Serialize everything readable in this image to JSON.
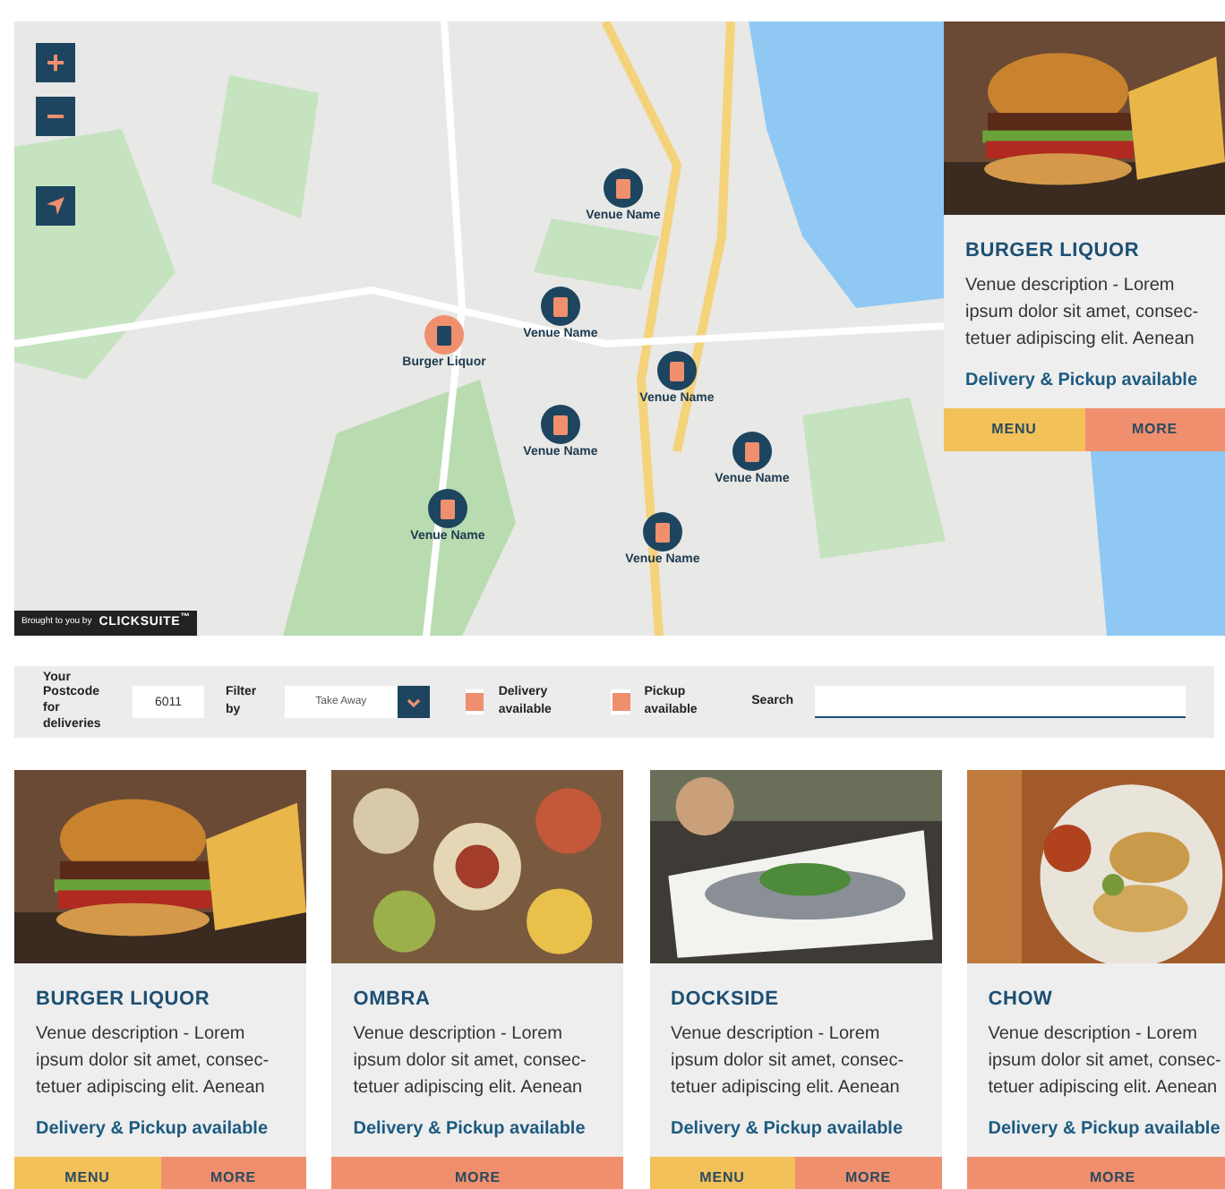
{
  "map": {
    "controls": [
      {
        "kind": "zoom_in",
        "label": "+"
      },
      {
        "kind": "zoom_out",
        "label": "−"
      },
      {
        "kind": "locate"
      }
    ],
    "markers": [
      {
        "label": "Venue Name",
        "selected": false
      },
      {
        "label": "Venue Name",
        "selected": false
      },
      {
        "label": "Burger Liquor",
        "selected": true
      },
      {
        "label": "Venue Name",
        "selected": false
      },
      {
        "label": "Venue Name",
        "selected": false
      },
      {
        "label": "Venue Name",
        "selected": false
      },
      {
        "label": "Venue Name",
        "selected": false
      },
      {
        "label": "Venue Name",
        "selected": false
      }
    ],
    "credit": {
      "prefix": "Brought to you by",
      "brand": "CLICKSUITE",
      "mark": "™"
    },
    "popup": {
      "name": "BURGER LIQUOR",
      "description": "Venue description - Lorem ipsum dolor sit amet, consec-tetuer adipiscing elit. Aenean",
      "availability": "Delivery & Pickup available",
      "buttons": [
        {
          "kind": "menu",
          "label": "MENU"
        },
        {
          "kind": "more",
          "label": "MORE"
        }
      ]
    }
  },
  "filters": {
    "postcode_label": "Your Postcode for deliveries",
    "postcode": "6011",
    "filter_label": "Filter by",
    "filter_value": "Take Away",
    "delivery": {
      "label": "Delivery available",
      "checked": true
    },
    "pickup": {
      "label": "Pickup available",
      "checked": true
    },
    "search_label": "Search"
  },
  "venues": [
    {
      "name": "BURGER LIQUOR",
      "description": "Venue description - Lorem ipsum dolor sit amet, consec-tetuer adipiscing elit. Aenean",
      "availability": "Delivery & Pickup available",
      "buttons": [
        {
          "kind": "menu",
          "label": "MENU"
        },
        {
          "kind": "more",
          "label": "MORE"
        }
      ]
    },
    {
      "name": "OMBRA",
      "description": "Venue description - Lorem ipsum dolor sit amet, consec-tetuer adipiscing elit. Aenean",
      "availability": "Delivery & Pickup available",
      "buttons": [
        {
          "kind": "more",
          "label": "MORE"
        }
      ]
    },
    {
      "name": "DOCKSIDE",
      "description": "Venue description - Lorem ipsum dolor sit amet, consec-tetuer adipiscing elit. Aenean",
      "availability": "Delivery & Pickup available",
      "buttons": [
        {
          "kind": "menu",
          "label": "MENU"
        },
        {
          "kind": "more",
          "label": "MORE"
        }
      ]
    },
    {
      "name": "CHOW",
      "description": "Venue description - Lorem ipsum dolor sit amet, consec-tetuer adipiscing elit. Aenean",
      "availability": "Delivery & Pickup available",
      "buttons": [
        {
          "kind": "more",
          "label": "MORE"
        }
      ]
    }
  ]
}
